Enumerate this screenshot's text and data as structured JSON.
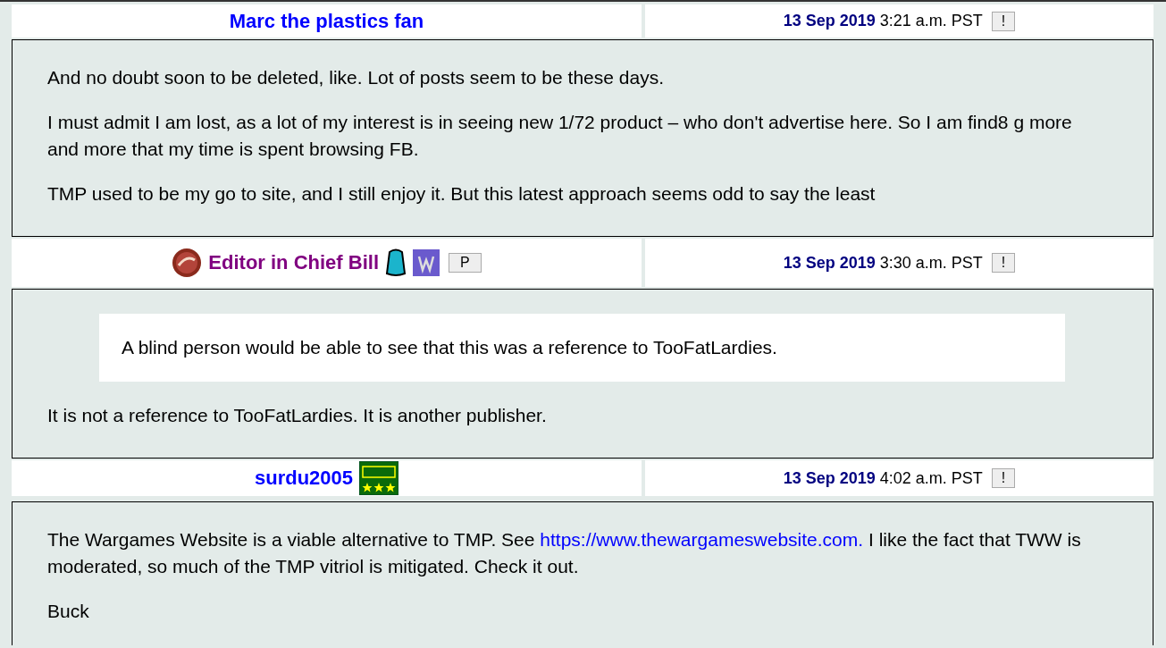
{
  "posts": [
    {
      "author": "Marc the plastics fan",
      "color": "#0000ff",
      "date": "13 Sep 2019",
      "time": "3:21 a.m. PST",
      "flag": "!",
      "body": [
        {
          "kind": "text",
          "parts": [
            {
              "kind": "plain",
              "text": "And no doubt soon to be deleted, like. Lot of posts seem to be these days."
            }
          ]
        },
        {
          "kind": "text",
          "parts": [
            {
              "kind": "plain",
              "text": "I must admit I am lost, as a lot of my interest is in seeing new 1/72 product – who don't advertise here. So I am find8 g more and more that my time is spent browsing FB."
            }
          ]
        },
        {
          "kind": "text",
          "parts": [
            {
              "kind": "plain",
              "text": "TMP used to be my go to site, and I still enjoy it. But this latest approach seems odd to say the least"
            }
          ]
        }
      ]
    },
    {
      "author": "Editor in Chief Bill",
      "color": "#800080",
      "badges": [
        {
          "kind": "cap"
        },
        {
          "kind": "backpack"
        },
        {
          "kind": "w"
        },
        {
          "kind": "button",
          "label": "P"
        }
      ],
      "date": "13 Sep 2019",
      "time": "3:30 a.m. PST",
      "flag": "!",
      "body": [
        {
          "kind": "quote",
          "parts": [
            {
              "kind": "plain",
              "text": "A blind person would be able to see that this was a reference to TooFatLardies."
            }
          ]
        },
        {
          "kind": "text",
          "parts": [
            {
              "kind": "plain",
              "text": "It is not a reference to TooFatLardies. It is another publisher."
            }
          ]
        }
      ]
    },
    {
      "author": "surdu2005",
      "color": "#0000ff",
      "badges": [
        {
          "kind": "tmp"
        }
      ],
      "date": "13 Sep 2019",
      "time": "4:02 a.m. PST",
      "flag": "!",
      "body": [
        {
          "kind": "text",
          "parts": [
            {
              "kind": "plain",
              "text": "The Wargames Website is a viable alternative to TMP. See "
            },
            {
              "kind": "link",
              "text": "https://www.thewargameswebsite.com."
            },
            {
              "kind": "plain",
              "text": " I like the fact that TWW is moderated, so much of the TMP vitriol is mitigated. Check it out."
            }
          ]
        },
        {
          "kind": "text",
          "parts": [
            {
              "kind": "plain",
              "text": "Buck"
            }
          ]
        }
      ]
    }
  ]
}
